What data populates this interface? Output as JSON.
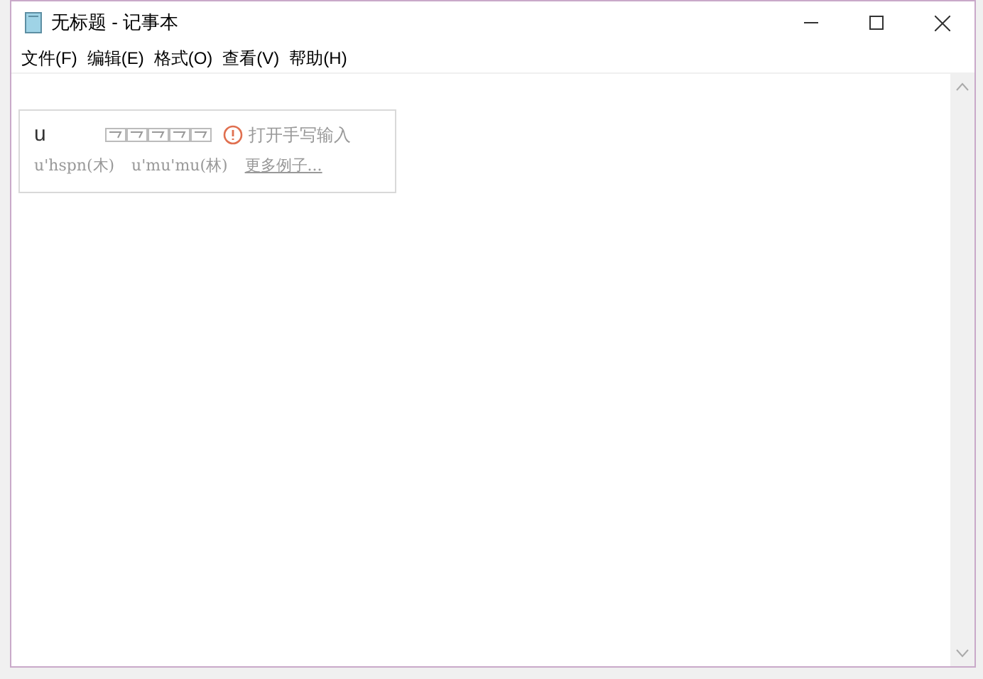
{
  "window": {
    "title": "无标题 - 记事本"
  },
  "menu": [
    "文件(F)",
    "编辑(E)",
    "格式(O)",
    "查看(V)",
    "帮助(H)"
  ],
  "ime": {
    "input": "u",
    "handwriting": "打开手写输入",
    "examples": [
      "u'hspn(木)",
      "u'mu'mu(林)"
    ],
    "more_link": "更多例子..."
  }
}
